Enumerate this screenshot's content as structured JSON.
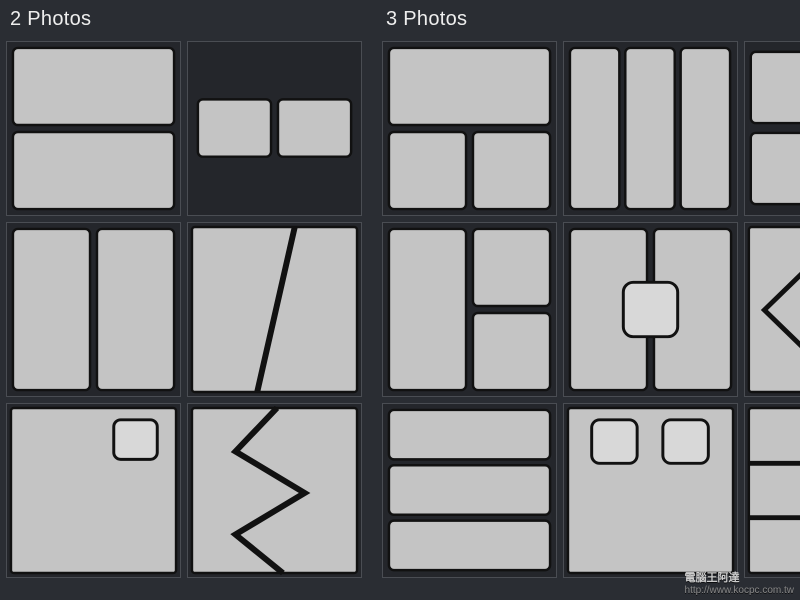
{
  "sections": {
    "twoPhotos": {
      "title": "2 Photos"
    },
    "threePhotos": {
      "title": "3 Photos"
    }
  },
  "watermark": {
    "line1": "電腦王阿達",
    "line2": "http://www.kocpc.com.tw"
  },
  "cellFill": "#c4c4c4",
  "cellStroke": "#1b1b1b",
  "tileBg": "#24262b",
  "layouts": {
    "twoPhotos": [
      "two-horizontal-stack",
      "two-small-side-by-side",
      "two-vertical-split",
      "two-diagonal-split",
      "one-large-pip-topright",
      "two-zigzag-split"
    ],
    "threePhotos": [
      "one-top-two-bottom",
      "three-vertical-columns",
      "one-top-two-bottom-partial",
      "one-left-two-right-stack",
      "two-vertical-center-overlay",
      "diamond-overlay-partial",
      "three-horizontal-rows",
      "two-pip-on-large",
      "lines-partial"
    ]
  }
}
